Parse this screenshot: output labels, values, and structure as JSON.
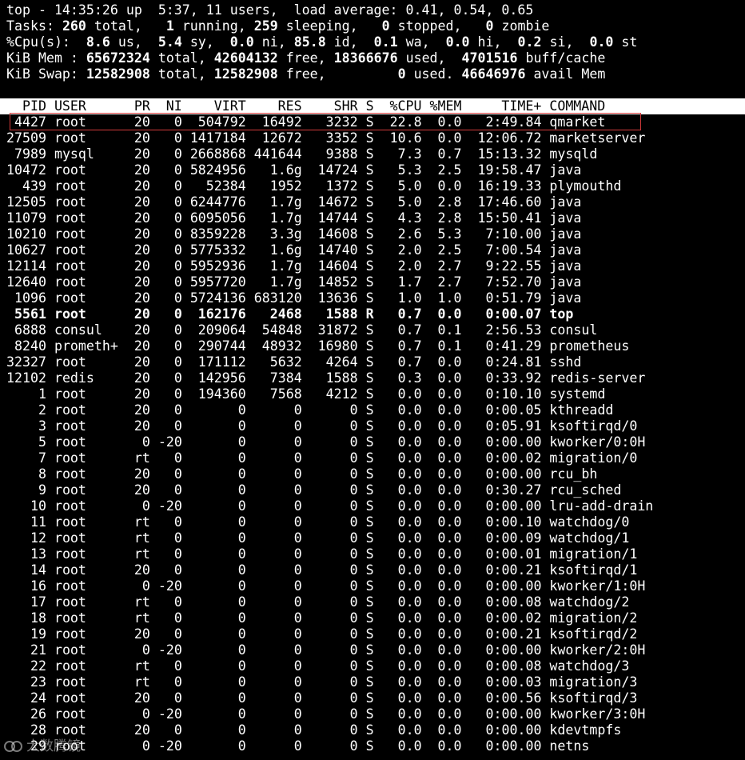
{
  "summary": {
    "line1": "top - 14:35:26 up  5:37, 11 users,  load average: 0.41, 0.54, 0.65",
    "tasks": {
      "prefix": "Tasks: ",
      "total": "260",
      "t1": " total,   ",
      "running": "1",
      "t2": " running, ",
      "sleeping": "259",
      "t3": " sleeping,   ",
      "stopped": "0",
      "t4": " stopped,   ",
      "zombie": "0",
      "t5": " zombie"
    },
    "cpu": {
      "prefix": "%Cpu(s):  ",
      "us": "8.6",
      "t1": " us,  ",
      "sy": "5.4",
      "t2": " sy,  ",
      "ni": "0.0",
      "t3": " ni, ",
      "id": "85.8",
      "t4": " id,  ",
      "wa": "0.1",
      "t5": " wa,  ",
      "hi": "0.0",
      "t6": " hi,  ",
      "si": "0.2",
      "t7": " si,  ",
      "st": "0.0",
      "t8": " st"
    },
    "mem": {
      "prefix": "KiB Mem : ",
      "total": "65672324",
      "t1": " total, ",
      "free": "42604132",
      "t2": " free, ",
      "used": "18366676",
      "t3": " used,  ",
      "buff": "4701516",
      "t4": " buff/cache"
    },
    "swap": {
      "prefix": "KiB Swap: ",
      "total": "12582908",
      "t1": " total, ",
      "free": "12582908",
      "t2": " free,         ",
      "used": "0",
      "t3": " used. ",
      "avail": "46646976",
      "t4": " avail Mem"
    }
  },
  "columns": [
    "PID",
    "USER",
    "PR",
    "NI",
    "VIRT",
    "RES",
    "SHR",
    "S",
    "%CPU",
    "%MEM",
    "TIME+",
    "COMMAND"
  ],
  "header_line": "  PID USER      PR  NI    VIRT    RES    SHR S  %CPU %MEM     TIME+ COMMAND",
  "processes": [
    {
      "pid": "4427",
      "user": "root",
      "pr": "20",
      "ni": "0",
      "virt": "504792",
      "res": "16492",
      "shr": "3232",
      "s": "S",
      "cpu": "22.8",
      "mem": "0.0",
      "time": "2:49.84",
      "cmd": "qmarket"
    },
    {
      "pid": "27509",
      "user": "root",
      "pr": "20",
      "ni": "0",
      "virt": "1417184",
      "res": "12672",
      "shr": "3352",
      "s": "S",
      "cpu": "10.6",
      "mem": "0.0",
      "time": "12:06.72",
      "cmd": "marketserver"
    },
    {
      "pid": "7989",
      "user": "mysql",
      "pr": "20",
      "ni": "0",
      "virt": "2668868",
      "res": "441644",
      "shr": "9388",
      "s": "S",
      "cpu": "7.3",
      "mem": "0.7",
      "time": "15:13.32",
      "cmd": "mysqld"
    },
    {
      "pid": "10472",
      "user": "root",
      "pr": "20",
      "ni": "0",
      "virt": "5824956",
      "res": "1.6g",
      "shr": "14724",
      "s": "S",
      "cpu": "5.3",
      "mem": "2.5",
      "time": "19:58.47",
      "cmd": "java"
    },
    {
      "pid": "439",
      "user": "root",
      "pr": "20",
      "ni": "0",
      "virt": "52384",
      "res": "1952",
      "shr": "1372",
      "s": "S",
      "cpu": "5.0",
      "mem": "0.0",
      "time": "16:19.33",
      "cmd": "plymouthd"
    },
    {
      "pid": "12505",
      "user": "root",
      "pr": "20",
      "ni": "0",
      "virt": "6244776",
      "res": "1.7g",
      "shr": "14672",
      "s": "S",
      "cpu": "5.0",
      "mem": "2.8",
      "time": "17:46.60",
      "cmd": "java"
    },
    {
      "pid": "11079",
      "user": "root",
      "pr": "20",
      "ni": "0",
      "virt": "6095056",
      "res": "1.7g",
      "shr": "14744",
      "s": "S",
      "cpu": "4.3",
      "mem": "2.8",
      "time": "15:50.41",
      "cmd": "java"
    },
    {
      "pid": "10210",
      "user": "root",
      "pr": "20",
      "ni": "0",
      "virt": "8359228",
      "res": "3.3g",
      "shr": "14608",
      "s": "S",
      "cpu": "2.6",
      "mem": "5.3",
      "time": "7:10.00",
      "cmd": "java"
    },
    {
      "pid": "10627",
      "user": "root",
      "pr": "20",
      "ni": "0",
      "virt": "5775332",
      "res": "1.6g",
      "shr": "14740",
      "s": "S",
      "cpu": "2.0",
      "mem": "2.5",
      "time": "7:00.54",
      "cmd": "java"
    },
    {
      "pid": "12114",
      "user": "root",
      "pr": "20",
      "ni": "0",
      "virt": "5952936",
      "res": "1.7g",
      "shr": "14604",
      "s": "S",
      "cpu": "2.0",
      "mem": "2.7",
      "time": "9:22.55",
      "cmd": "java"
    },
    {
      "pid": "12640",
      "user": "root",
      "pr": "20",
      "ni": "0",
      "virt": "5957720",
      "res": "1.7g",
      "shr": "14852",
      "s": "S",
      "cpu": "1.7",
      "mem": "2.7",
      "time": "7:52.70",
      "cmd": "java"
    },
    {
      "pid": "1096",
      "user": "root",
      "pr": "20",
      "ni": "0",
      "virt": "5724136",
      "res": "683120",
      "shr": "13636",
      "s": "S",
      "cpu": "1.0",
      "mem": "1.0",
      "time": "0:51.79",
      "cmd": "java"
    },
    {
      "pid": "5561",
      "user": "root",
      "pr": "20",
      "ni": "0",
      "virt": "162176",
      "res": "2468",
      "shr": "1588",
      "s": "R",
      "cpu": "0.7",
      "mem": "0.0",
      "time": "0:00.07",
      "cmd": "top",
      "bold": true
    },
    {
      "pid": "6888",
      "user": "consul",
      "pr": "20",
      "ni": "0",
      "virt": "209064",
      "res": "54848",
      "shr": "31872",
      "s": "S",
      "cpu": "0.7",
      "mem": "0.1",
      "time": "2:56.53",
      "cmd": "consul"
    },
    {
      "pid": "8240",
      "user": "prometh+",
      "pr": "20",
      "ni": "0",
      "virt": "290744",
      "res": "48932",
      "shr": "16980",
      "s": "S",
      "cpu": "0.7",
      "mem": "0.1",
      "time": "0:41.29",
      "cmd": "prometheus"
    },
    {
      "pid": "32327",
      "user": "root",
      "pr": "20",
      "ni": "0",
      "virt": "171112",
      "res": "5632",
      "shr": "4264",
      "s": "S",
      "cpu": "0.7",
      "mem": "0.0",
      "time": "0:24.81",
      "cmd": "sshd"
    },
    {
      "pid": "12102",
      "user": "redis",
      "pr": "20",
      "ni": "0",
      "virt": "142956",
      "res": "7384",
      "shr": "1588",
      "s": "S",
      "cpu": "0.3",
      "mem": "0.0",
      "time": "0:33.92",
      "cmd": "redis-server"
    },
    {
      "pid": "1",
      "user": "root",
      "pr": "20",
      "ni": "0",
      "virt": "194360",
      "res": "7568",
      "shr": "4212",
      "s": "S",
      "cpu": "0.0",
      "mem": "0.0",
      "time": "0:10.10",
      "cmd": "systemd"
    },
    {
      "pid": "2",
      "user": "root",
      "pr": "20",
      "ni": "0",
      "virt": "0",
      "res": "0",
      "shr": "0",
      "s": "S",
      "cpu": "0.0",
      "mem": "0.0",
      "time": "0:00.05",
      "cmd": "kthreadd"
    },
    {
      "pid": "3",
      "user": "root",
      "pr": "20",
      "ni": "0",
      "virt": "0",
      "res": "0",
      "shr": "0",
      "s": "S",
      "cpu": "0.0",
      "mem": "0.0",
      "time": "0:05.91",
      "cmd": "ksoftirqd/0"
    },
    {
      "pid": "5",
      "user": "root",
      "pr": "0",
      "ni": "-20",
      "virt": "0",
      "res": "0",
      "shr": "0",
      "s": "S",
      "cpu": "0.0",
      "mem": "0.0",
      "time": "0:00.00",
      "cmd": "kworker/0:0H"
    },
    {
      "pid": "7",
      "user": "root",
      "pr": "rt",
      "ni": "0",
      "virt": "0",
      "res": "0",
      "shr": "0",
      "s": "S",
      "cpu": "0.0",
      "mem": "0.0",
      "time": "0:00.02",
      "cmd": "migration/0"
    },
    {
      "pid": "8",
      "user": "root",
      "pr": "20",
      "ni": "0",
      "virt": "0",
      "res": "0",
      "shr": "0",
      "s": "S",
      "cpu": "0.0",
      "mem": "0.0",
      "time": "0:00.00",
      "cmd": "rcu_bh"
    },
    {
      "pid": "9",
      "user": "root",
      "pr": "20",
      "ni": "0",
      "virt": "0",
      "res": "0",
      "shr": "0",
      "s": "S",
      "cpu": "0.0",
      "mem": "0.0",
      "time": "0:30.27",
      "cmd": "rcu_sched"
    },
    {
      "pid": "10",
      "user": "root",
      "pr": "0",
      "ni": "-20",
      "virt": "0",
      "res": "0",
      "shr": "0",
      "s": "S",
      "cpu": "0.0",
      "mem": "0.0",
      "time": "0:00.00",
      "cmd": "lru-add-drain"
    },
    {
      "pid": "11",
      "user": "root",
      "pr": "rt",
      "ni": "0",
      "virt": "0",
      "res": "0",
      "shr": "0",
      "s": "S",
      "cpu": "0.0",
      "mem": "0.0",
      "time": "0:00.10",
      "cmd": "watchdog/0"
    },
    {
      "pid": "12",
      "user": "root",
      "pr": "rt",
      "ni": "0",
      "virt": "0",
      "res": "0",
      "shr": "0",
      "s": "S",
      "cpu": "0.0",
      "mem": "0.0",
      "time": "0:00.09",
      "cmd": "watchdog/1"
    },
    {
      "pid": "13",
      "user": "root",
      "pr": "rt",
      "ni": "0",
      "virt": "0",
      "res": "0",
      "shr": "0",
      "s": "S",
      "cpu": "0.0",
      "mem": "0.0",
      "time": "0:00.01",
      "cmd": "migration/1"
    },
    {
      "pid": "14",
      "user": "root",
      "pr": "20",
      "ni": "0",
      "virt": "0",
      "res": "0",
      "shr": "0",
      "s": "S",
      "cpu": "0.0",
      "mem": "0.0",
      "time": "0:00.21",
      "cmd": "ksoftirqd/1"
    },
    {
      "pid": "16",
      "user": "root",
      "pr": "0",
      "ni": "-20",
      "virt": "0",
      "res": "0",
      "shr": "0",
      "s": "S",
      "cpu": "0.0",
      "mem": "0.0",
      "time": "0:00.00",
      "cmd": "kworker/1:0H"
    },
    {
      "pid": "17",
      "user": "root",
      "pr": "rt",
      "ni": "0",
      "virt": "0",
      "res": "0",
      "shr": "0",
      "s": "S",
      "cpu": "0.0",
      "mem": "0.0",
      "time": "0:00.08",
      "cmd": "watchdog/2"
    },
    {
      "pid": "18",
      "user": "root",
      "pr": "rt",
      "ni": "0",
      "virt": "0",
      "res": "0",
      "shr": "0",
      "s": "S",
      "cpu": "0.0",
      "mem": "0.0",
      "time": "0:00.02",
      "cmd": "migration/2"
    },
    {
      "pid": "19",
      "user": "root",
      "pr": "20",
      "ni": "0",
      "virt": "0",
      "res": "0",
      "shr": "0",
      "s": "S",
      "cpu": "0.0",
      "mem": "0.0",
      "time": "0:00.21",
      "cmd": "ksoftirqd/2"
    },
    {
      "pid": "21",
      "user": "root",
      "pr": "0",
      "ni": "-20",
      "virt": "0",
      "res": "0",
      "shr": "0",
      "s": "S",
      "cpu": "0.0",
      "mem": "0.0",
      "time": "0:00.00",
      "cmd": "kworker/2:0H"
    },
    {
      "pid": "22",
      "user": "root",
      "pr": "rt",
      "ni": "0",
      "virt": "0",
      "res": "0",
      "shr": "0",
      "s": "S",
      "cpu": "0.0",
      "mem": "0.0",
      "time": "0:00.08",
      "cmd": "watchdog/3"
    },
    {
      "pid": "23",
      "user": "root",
      "pr": "rt",
      "ni": "0",
      "virt": "0",
      "res": "0",
      "shr": "0",
      "s": "S",
      "cpu": "0.0",
      "mem": "0.0",
      "time": "0:00.03",
      "cmd": "migration/3"
    },
    {
      "pid": "24",
      "user": "root",
      "pr": "20",
      "ni": "0",
      "virt": "0",
      "res": "0",
      "shr": "0",
      "s": "S",
      "cpu": "0.0",
      "mem": "0.0",
      "time": "0:00.56",
      "cmd": "ksoftirqd/3"
    },
    {
      "pid": "26",
      "user": "root",
      "pr": "0",
      "ni": "-20",
      "virt": "0",
      "res": "0",
      "shr": "0",
      "s": "S",
      "cpu": "0.0",
      "mem": "0.0",
      "time": "0:00.00",
      "cmd": "kworker/3:0H"
    },
    {
      "pid": "28",
      "user": "root",
      "pr": "20",
      "ni": "0",
      "virt": "0",
      "res": "0",
      "shr": "0",
      "s": "S",
      "cpu": "0.0",
      "mem": "0.0",
      "time": "0:00.00",
      "cmd": "kdevtmpfs"
    },
    {
      "pid": "29",
      "user": "root",
      "pr": "0",
      "ni": "-20",
      "virt": "0",
      "res": "0",
      "shr": "0",
      "s": "S",
      "cpu": "0.0",
      "mem": "0.0",
      "time": "0:00.00",
      "cmd": "netns"
    }
  ],
  "highlight": {
    "pid": "4427",
    "color": "#d23a3a"
  },
  "watermark": {
    "text": "大数腾镜",
    "icon": "logo-icon"
  },
  "colors": {
    "background": "#000000",
    "foreground": "#ffffff",
    "header_bg": "#ffffff",
    "header_fg": "#000000"
  }
}
